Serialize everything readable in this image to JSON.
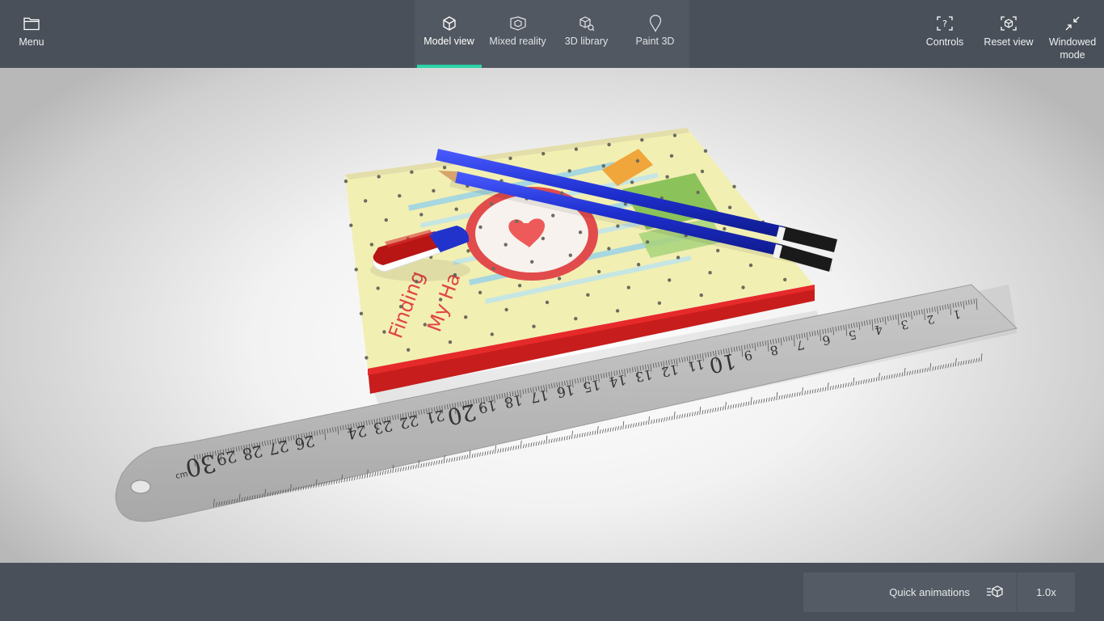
{
  "topbar": {
    "menu_label": "Menu",
    "tabs": [
      {
        "label": "Model view",
        "active": true
      },
      {
        "label": "Mixed reality",
        "active": false
      },
      {
        "label": "3D library",
        "active": false
      },
      {
        "label": "Paint 3D",
        "active": false
      }
    ],
    "controls_label": "Controls",
    "reset_view_label": "Reset view",
    "windowed_mode_label": "Windowed\nmode"
  },
  "scene": {
    "book_title_line1": "Finding",
    "book_title_line2": "My Ha",
    "ruler_unit": "cm",
    "ruler_numbers": [
      "1",
      "2",
      "3",
      "4",
      "5",
      "6",
      "7",
      "8",
      "9",
      "10",
      "11",
      "12",
      "13",
      "14",
      "15",
      "16",
      "17",
      "18",
      "19",
      "20",
      "21",
      "22",
      "23",
      "24",
      "26",
      "27",
      "28",
      "29",
      "30"
    ]
  },
  "bottombar": {
    "quick_animations_label": "Quick animations",
    "speed_label": "1.0x"
  },
  "colors": {
    "accent": "#2bd4a8",
    "bar": "#4a5059",
    "tab_group": "#525861"
  }
}
